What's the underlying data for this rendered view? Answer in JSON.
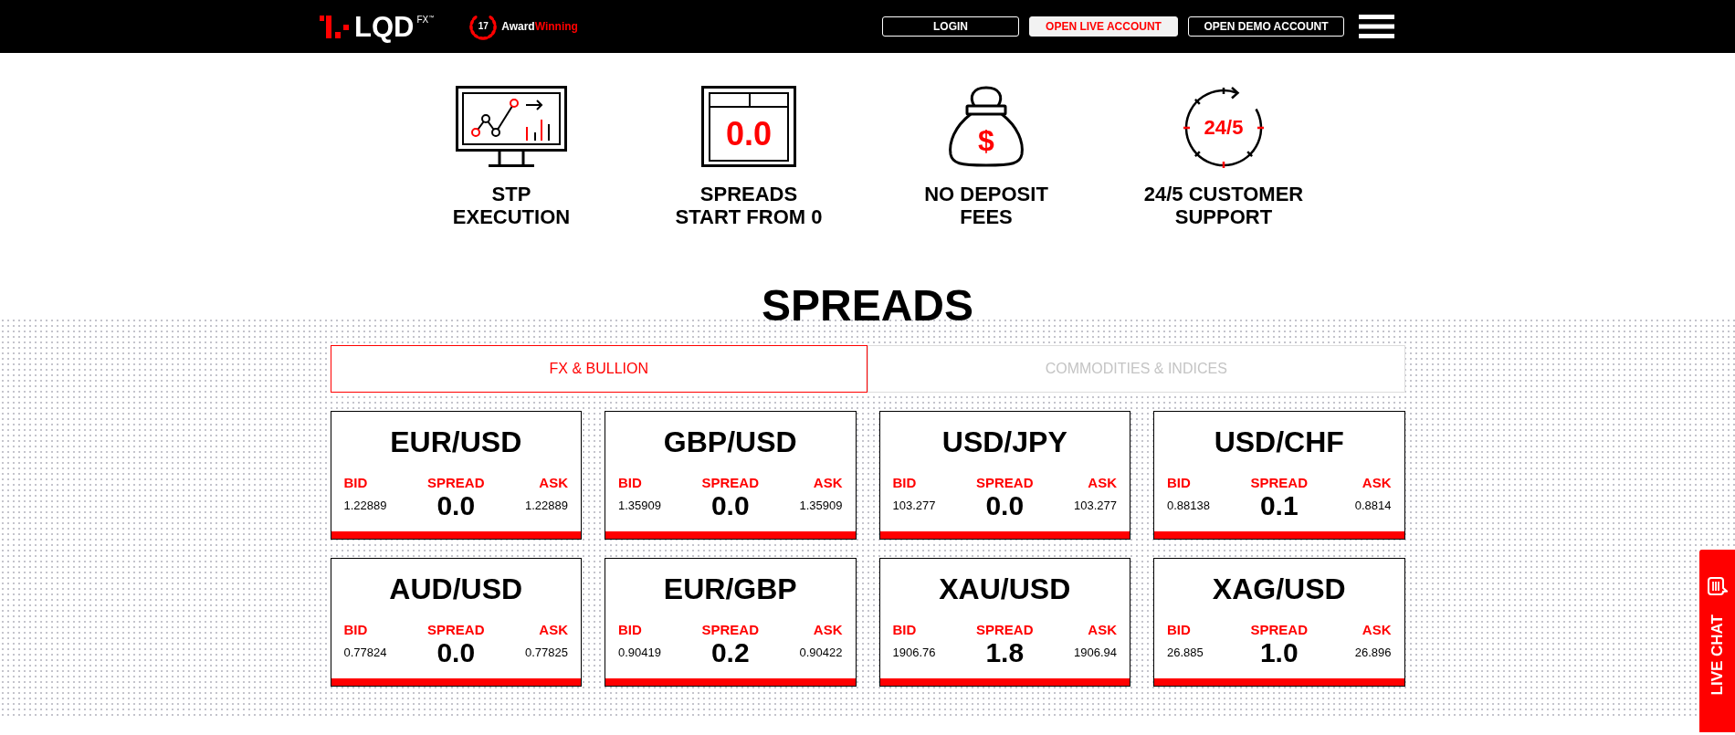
{
  "header": {
    "logo": {
      "text": "LQD",
      "superscript": "FX",
      "mark": "™"
    },
    "award": {
      "number": "17",
      "label": "Award",
      "highlight": "Winning"
    },
    "buttons": [
      {
        "label": "LOGIN",
        "kind": "outline"
      },
      {
        "label": "OPEN LIVE ACCOUNT",
        "kind": "filled"
      },
      {
        "label": "OPEN DEMO ACCOUNT",
        "kind": "outline"
      }
    ]
  },
  "features": [
    {
      "kind": "monitor",
      "title": [
        "STP",
        "EXECUTION"
      ]
    },
    {
      "kind": "board",
      "icon_text": "0.0",
      "title": [
        "SPREADS",
        "START FROM 0"
      ]
    },
    {
      "kind": "bag",
      "icon_text": "$",
      "title": [
        "NO DEPOSIT",
        "FEES"
      ]
    },
    {
      "kind": "clock",
      "icon_text": "24/5",
      "title": [
        "24/5 CUSTOMER",
        "SUPPORT"
      ]
    }
  ],
  "spreads": {
    "title": "SPREADS",
    "tabs": [
      {
        "label": "FX & BULLION",
        "selected": true
      },
      {
        "label": "COMMODITIES & INDICES",
        "selected": false
      }
    ],
    "cards": [
      {
        "pair": "EUR/USD",
        "bid_label": "BID",
        "spread_label": "SPREAD",
        "ask_label": "ASK",
        "bid": "1.22889",
        "spread": "0.0",
        "ask": "1.22889"
      },
      {
        "pair": "GBP/USD",
        "bid_label": "BID",
        "spread_label": "SPREAD",
        "ask_label": "ASK",
        "bid": "1.35909",
        "spread": "0.0",
        "ask": "1.35909"
      },
      {
        "pair": "USD/JPY",
        "bid_label": "BID",
        "spread_label": "SPREAD",
        "ask_label": "ASK",
        "bid": "103.277",
        "spread": "0.0",
        "ask": "103.277"
      },
      {
        "pair": "USD/CHF",
        "bid_label": "BID",
        "spread_label": "SPREAD",
        "ask_label": "ASK",
        "bid": "0.88138",
        "spread": "0.1",
        "ask": "0.8814"
      },
      {
        "pair": "AUD/USD",
        "bid_label": "BID",
        "spread_label": "SPREAD",
        "ask_label": "ASK",
        "bid": "0.77824",
        "spread": "0.0",
        "ask": "0.77825"
      },
      {
        "pair": "EUR/GBP",
        "bid_label": "BID",
        "spread_label": "SPREAD",
        "ask_label": "ASK",
        "bid": "0.90419",
        "spread": "0.2",
        "ask": "0.90422"
      },
      {
        "pair": "XAU/USD",
        "bid_label": "BID",
        "spread_label": "SPREAD",
        "ask_label": "ASK",
        "bid": "1906.76",
        "spread": "1.8",
        "ask": "1906.94"
      },
      {
        "pair": "XAG/USD",
        "bid_label": "BID",
        "spread_label": "SPREAD",
        "ask_label": "ASK",
        "bid": "26.885",
        "spread": "1.0",
        "ask": "26.896"
      }
    ]
  },
  "live_chat": {
    "label": "LIVE CHAT"
  }
}
